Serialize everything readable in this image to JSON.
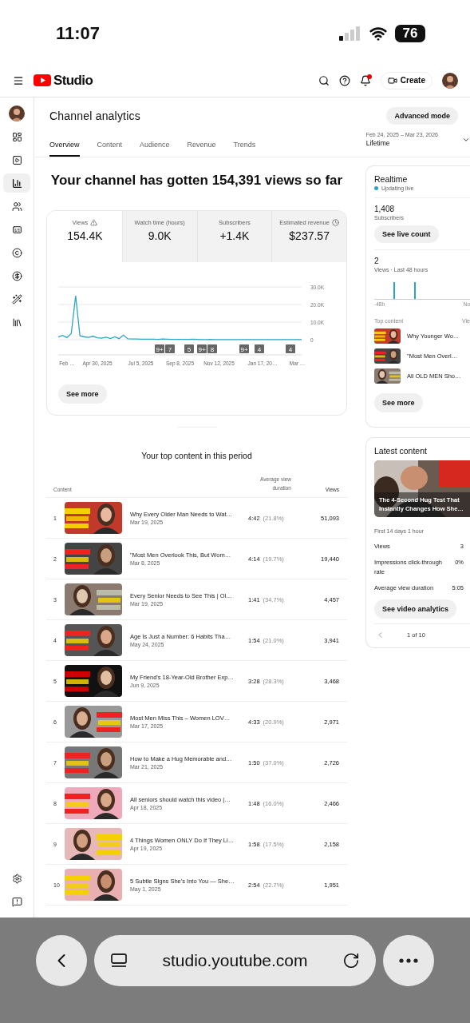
{
  "status_bar": {
    "time": "11:07",
    "battery": "76"
  },
  "header": {
    "logo_text": "Studio",
    "create_label": "Create",
    "notifications_unread": true
  },
  "sidebar": {
    "items": [
      {
        "kind": "avatar",
        "selected": false
      },
      {
        "kind": "dashboard",
        "selected": false
      },
      {
        "kind": "content",
        "selected": false
      },
      {
        "kind": "analytics",
        "selected": true
      },
      {
        "kind": "community",
        "selected": false
      },
      {
        "kind": "subtitles",
        "selected": false
      },
      {
        "kind": "copyright",
        "selected": false
      },
      {
        "kind": "earn",
        "selected": false
      },
      {
        "kind": "customization",
        "selected": false
      },
      {
        "kind": "library",
        "selected": false
      }
    ],
    "footer_items": [
      {
        "kind": "settings",
        "selected": false
      },
      {
        "kind": "feedback",
        "selected": false
      }
    ]
  },
  "page": {
    "title": "Channel analytics",
    "advanced_button": "Advanced mode",
    "tabs": [
      {
        "label": "Overview",
        "selected": true
      },
      {
        "label": "Content",
        "selected": false
      },
      {
        "label": "Audience",
        "selected": false
      },
      {
        "label": "Revenue",
        "selected": false
      },
      {
        "label": "Trends",
        "selected": false
      }
    ],
    "date_range": {
      "dates": "Feb 24, 2025 – Mar 23, 2026",
      "label": "Lifetime"
    }
  },
  "headline": "Your channel has gotten 154,391 views so far",
  "metrics": [
    {
      "label": "Views",
      "value": "154.4K",
      "selected": true,
      "kind": "warning"
    },
    {
      "label": "Watch time (hours)",
      "value": "9.0K",
      "selected": false
    },
    {
      "label": "Subscribers",
      "value": "+1.4K",
      "selected": false
    },
    {
      "label": "Estimated revenue",
      "value": "$237.57",
      "selected": false,
      "kind": "clock"
    }
  ],
  "chart_data": {
    "type": "line",
    "categories": [
      null,
      null,
      "Feb …",
      null,
      null,
      null,
      null,
      null,
      null,
      "Apr 30, 2025",
      null,
      null,
      null,
      null,
      null,
      null,
      null,
      null,
      null,
      "Jul 5, 2025",
      null,
      null,
      null,
      null,
      null,
      null,
      null,
      null,
      "Sep 8, 2025",
      null,
      null,
      null,
      null,
      null,
      null,
      null,
      null,
      "Nov 12, 2025",
      null,
      null,
      null,
      null,
      null,
      null,
      null,
      null,
      null,
      "Jan 17, 20…",
      null,
      null,
      null,
      null,
      null,
      null,
      null,
      "Mar …",
      null
    ],
    "series": [
      {
        "color": "#2ba4c4",
        "values": [
          1500,
          2400,
          1200,
          3500,
          25000,
          2200,
          1600,
          1300,
          1900,
          1100,
          800,
          1400,
          700,
          1600,
          600,
          2600,
          500,
          400,
          400,
          300,
          300,
          300,
          300,
          200,
          400,
          300,
          200,
          200,
          200,
          200,
          200,
          300,
          200,
          100,
          100,
          200,
          100,
          100,
          100,
          100,
          100,
          100,
          100,
          100,
          100,
          100,
          100,
          100,
          100,
          100,
          100,
          100,
          100,
          100,
          100,
          100,
          100
        ]
      }
    ],
    "ylim": [
      0,
      30000
    ],
    "yticks": [
      {
        "value": 0,
        "label": "0"
      },
      {
        "value": 10000,
        "label": "10.0K"
      },
      {
        "value": 20000,
        "label": "20.0K"
      },
      {
        "value": 30000,
        "label": "30.0K"
      }
    ],
    "annotations": [
      "9+",
      "7",
      "5",
      "9+",
      "8",
      "9+",
      "4",
      "4"
    ]
  },
  "see_more": "See more",
  "top_content": {
    "title": "Your top content in this period",
    "columns": [
      "Content",
      "Average view duration",
      "Views"
    ],
    "rows": [
      {
        "rank": "1",
        "title": "Why Every Older Man Needs to Wat…",
        "date": "Mar 19, 2025",
        "duration": "4:42",
        "percent": "(21.8%)",
        "views": "51,093"
      },
      {
        "rank": "2",
        "title": "\"Most Men Overlook This, But Wom…",
        "date": "Mar 8, 2025",
        "duration": "4:14",
        "percent": "(19.7%)",
        "views": "19,440"
      },
      {
        "rank": "3",
        "title": "Every Senior Needs to See This | Ol…",
        "date": "Mar 19, 2025",
        "duration": "1:41",
        "percent": "(34.7%)",
        "views": "4,457"
      },
      {
        "rank": "4",
        "title": "Age Is Just a Number: 6 Habits Tha…",
        "date": "May 24, 2025",
        "duration": "1:54",
        "percent": "(21.0%)",
        "views": "3,941"
      },
      {
        "rank": "5",
        "title": "My Friend's 18-Year-Old Brother Exp…",
        "date": "Jun 9, 2025",
        "duration": "3:28",
        "percent": "(28.3%)",
        "views": "3,468"
      },
      {
        "rank": "6",
        "title": "Most Men Miss This – Women LOV…",
        "date": "Mar 17, 2025",
        "duration": "4:33",
        "percent": "(20.9%)",
        "views": "2,971"
      },
      {
        "rank": "7",
        "title": "How to Make a Hug Memorable and…",
        "date": "Mar 21, 2025",
        "duration": "1:50",
        "percent": "(37.0%)",
        "views": "2,726"
      },
      {
        "rank": "8",
        "title": "All seniors should watch this video |…",
        "date": "Apr 18, 2025",
        "duration": "1:48",
        "percent": "(16.0%)",
        "views": "2,466"
      },
      {
        "rank": "9",
        "title": "4 Things Women ONLY Do If They Li…",
        "date": "Apr 19, 2025",
        "duration": "1:58",
        "percent": "(17.5%)",
        "views": "2,158"
      },
      {
        "rank": "10",
        "title": "5 Subtle Signs She's Into You — She…",
        "date": "May 1, 2025",
        "duration": "2:54",
        "percent": "(22.7%)",
        "views": "1,951"
      }
    ]
  },
  "realtime": {
    "title": "Realtime",
    "status": "Updating live",
    "subscribers": "1,408",
    "subscribers_label": "Subscribers",
    "live_button": "See live count",
    "views": "2",
    "views_label": "Views · Last 48 hours",
    "axis_start": "-48h",
    "axis_end": "No",
    "top_content_label": "Top content",
    "views_column_label": "Vie",
    "top_content": [
      {
        "title": "Why Younger Wo…"
      },
      {
        "title": "\"Most Men Overl…"
      },
      {
        "title": "All OLD MEN Sho…"
      }
    ],
    "see_more": "See more"
  },
  "latest": {
    "title": "Latest content",
    "video_title": "The 4-Second Hug Test That Instantly Changes How She…",
    "period": "First 14 days 1 hour",
    "stats": [
      {
        "label": "Views",
        "value": "3"
      },
      {
        "label": "Impressions click-through rate",
        "value": "0%"
      },
      {
        "label": "Average view duration",
        "value": "5:05"
      }
    ],
    "button": "See video analytics",
    "pager": "1 of 10"
  },
  "browser": {
    "url": "studio.youtube.com"
  }
}
